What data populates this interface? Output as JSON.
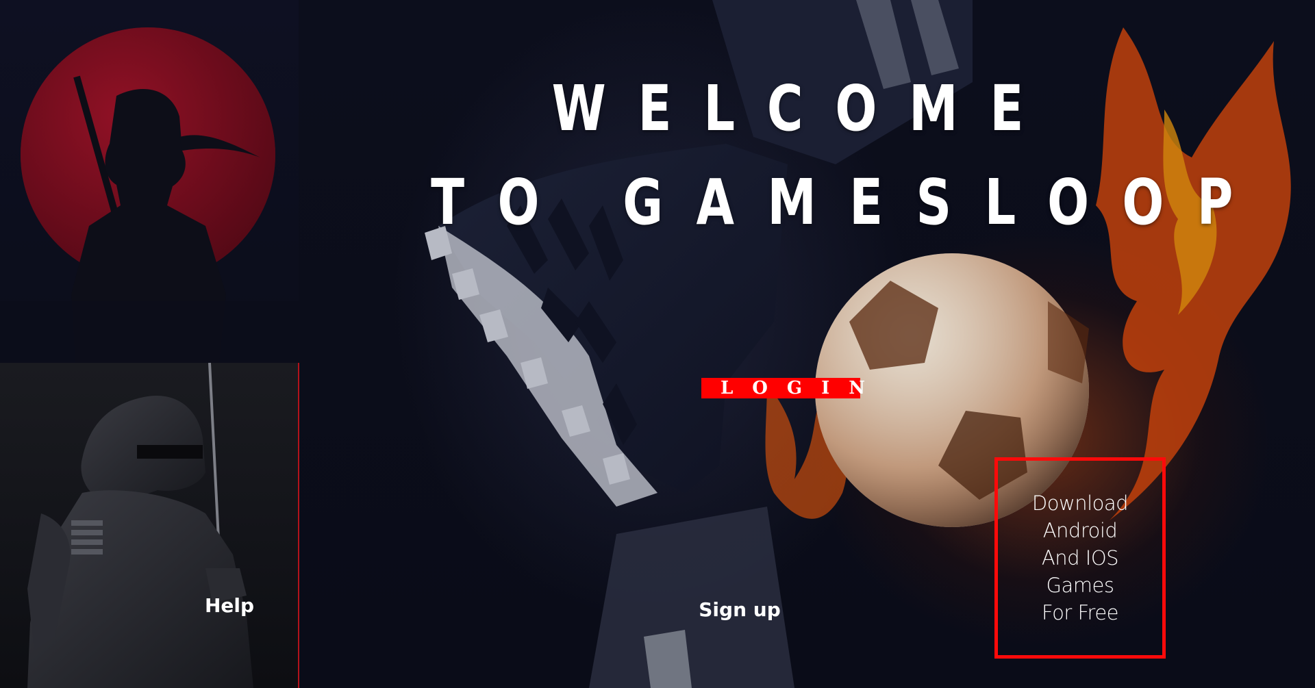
{
  "title": {
    "line1": "WELCOME",
    "line2": "TO GAMESLOOP"
  },
  "login": {
    "label": "LOGIN",
    "color": "#ff0000"
  },
  "signup": {
    "label": "Sign up"
  },
  "help": {
    "label": "Help"
  },
  "download": {
    "lines": [
      "Download",
      "Android",
      "And IOS",
      "Games",
      "For Free"
    ],
    "border_color": "#ff0a0a"
  },
  "colors": {
    "background": "#0b0d1a",
    "accent": "#ff0000",
    "divider": "#b3131b",
    "text": "#ffffff"
  },
  "images": {
    "hero": "soccer-ball-fire-icon",
    "top_left": "ninja-red-moon-icon",
    "bottom_left": "armored-ninja-icon"
  }
}
